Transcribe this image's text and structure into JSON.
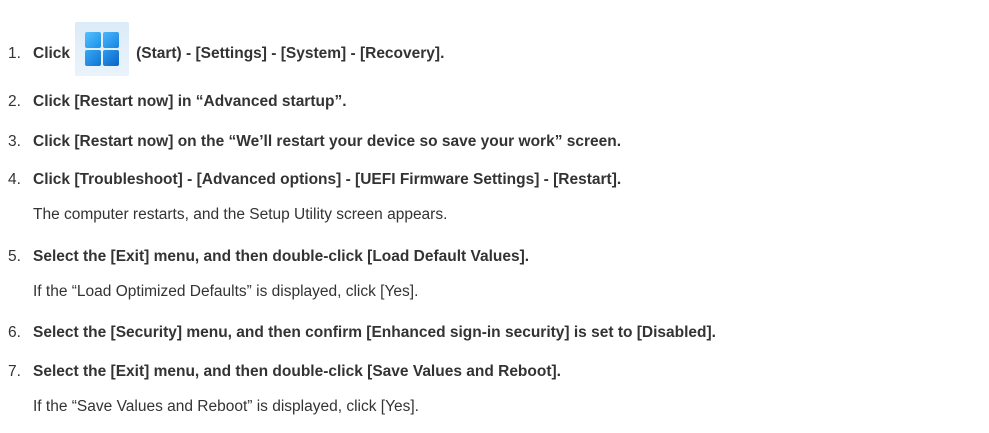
{
  "steps": [
    {
      "number": "1.",
      "before_icon": "Click",
      "icon": "windows-start-icon",
      "after_icon": "(Start) - [Settings] - [System] - [Recovery]."
    },
    {
      "number": "2.",
      "text": "Click [Restart now] in “Advanced startup”."
    },
    {
      "number": "3.",
      "text": "Click [Restart now] on the “We’ll restart your device so save your work” screen."
    },
    {
      "number": "4.",
      "text": "Click [Troubleshoot] - [Advanced options] - [UEFI Firmware Settings] - [Restart].",
      "note": "The computer restarts, and the Setup Utility screen appears."
    },
    {
      "number": "5.",
      "text": "Select the [Exit] menu, and then double-click [Load Default Values].",
      "note": "If the “Load Optimized Defaults” is displayed, click [Yes]."
    },
    {
      "number": "6.",
      "text": "Select the [Security] menu, and then confirm [Enhanced sign-in security] is set to [Disabled]."
    },
    {
      "number": "7.",
      "text": "Select the [Exit] menu, and then double-click [Save Values and Reboot].",
      "note": "If the “Save Values and Reboot” is displayed, click [Yes]."
    }
  ]
}
